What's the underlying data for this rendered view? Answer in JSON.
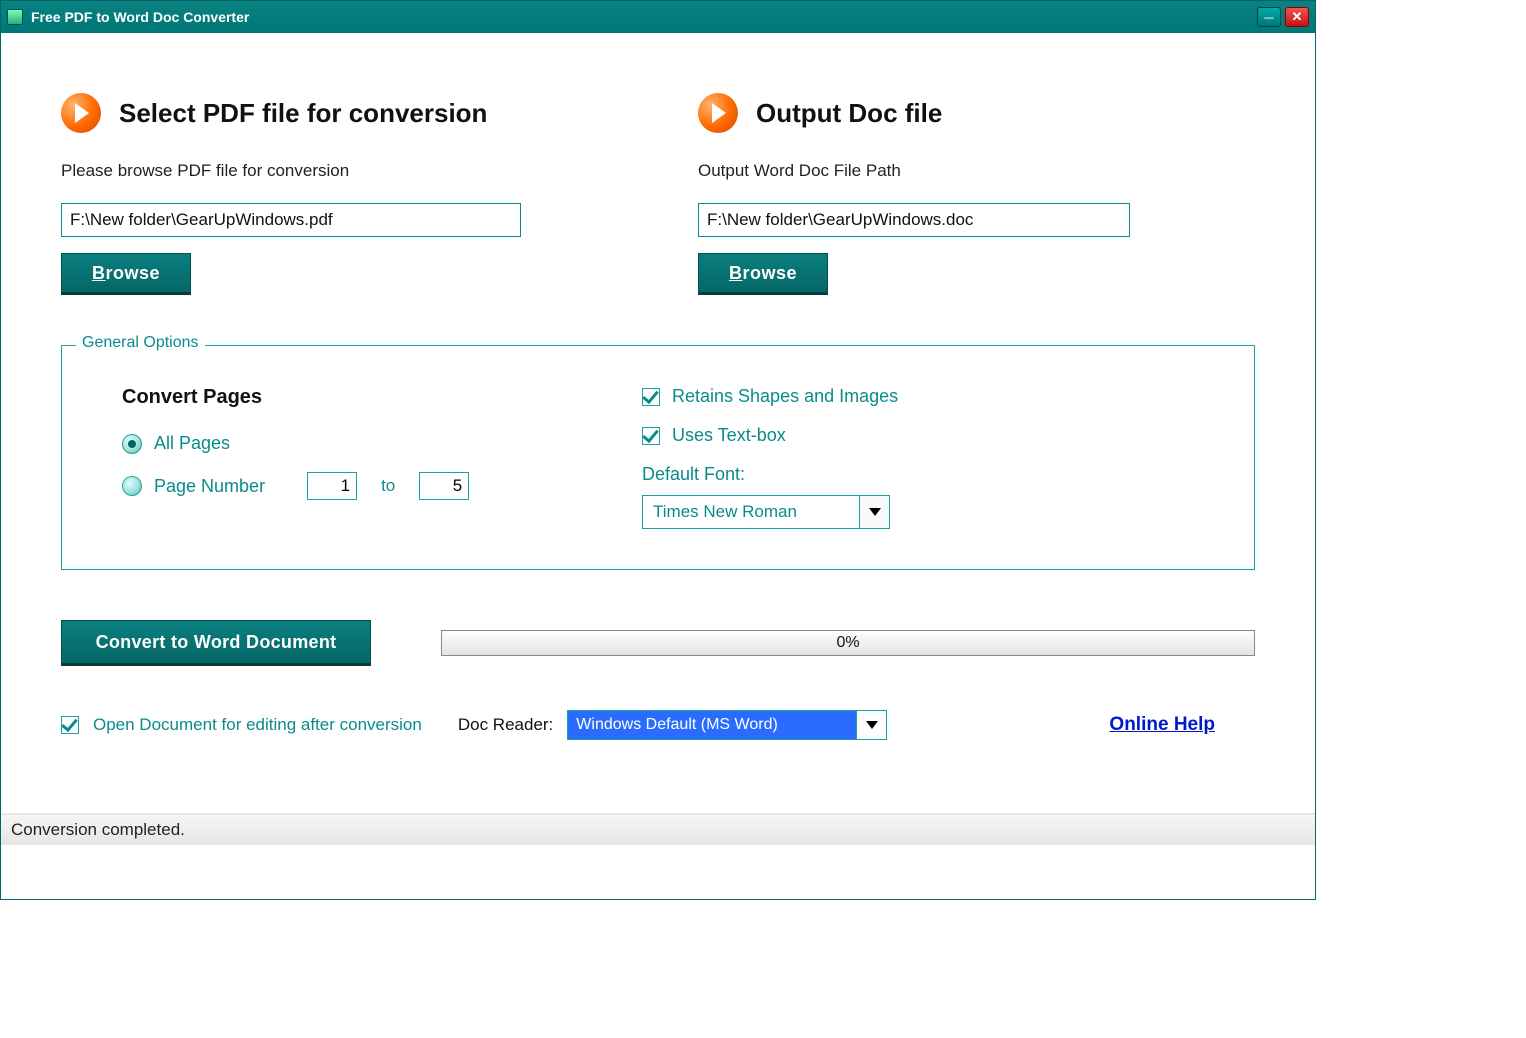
{
  "window": {
    "title": "Free PDF to Word Doc Converter"
  },
  "input_section": {
    "title": "Select PDF file for conversion",
    "subtitle": "Please browse PDF file for conversion",
    "path": "F:\\New folder\\GearUpWindows.pdf",
    "browse": "Browse"
  },
  "output_section": {
    "title": "Output Doc file",
    "subtitle": "Output Word Doc File Path",
    "path": "F:\\New folder\\GearUpWindows.doc",
    "browse": "Browse"
  },
  "options": {
    "legend": "General Options",
    "convert_title": "Convert Pages",
    "all_pages": "All Pages",
    "page_number": "Page Number",
    "page_from": "1",
    "to_label": "to",
    "page_to": "5",
    "retain_shapes": "Retains Shapes and Images",
    "uses_textbox": "Uses Text-box",
    "default_font_label": "Default Font:",
    "default_font": "Times New Roman"
  },
  "actions": {
    "convert": "Convert to Word Document",
    "progress": "0%"
  },
  "footer": {
    "open_after": "Open Document for editing after conversion",
    "reader_label": "Doc Reader:",
    "reader_value": "Windows Default (MS Word)",
    "help": "Online Help"
  },
  "status": "Conversion completed."
}
